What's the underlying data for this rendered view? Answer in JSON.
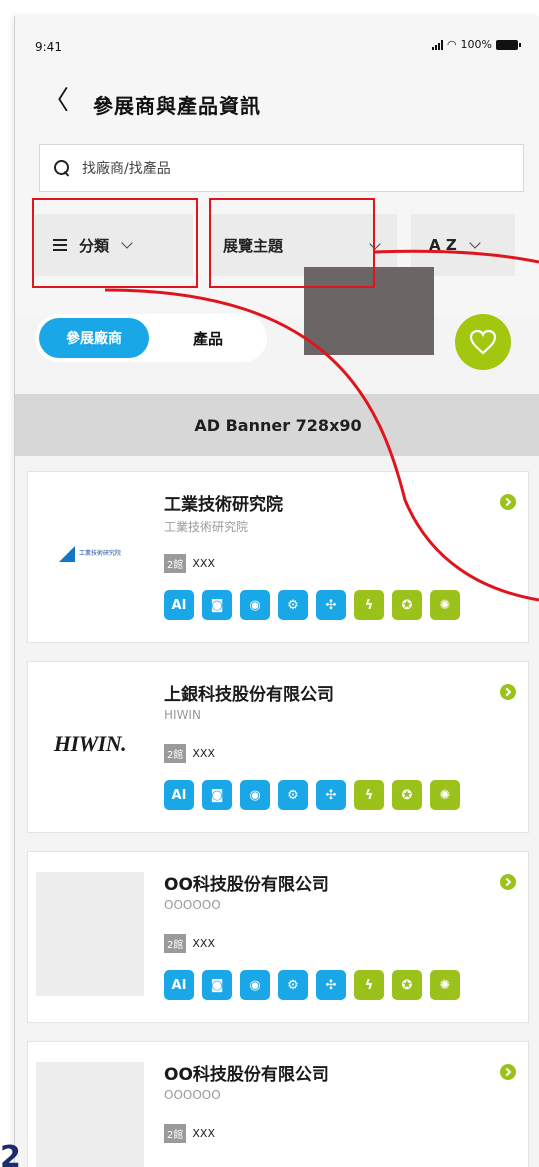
{
  "status": {
    "time": "9:41",
    "battery": "100%"
  },
  "header": {
    "back_icon": "chevron-left-icon",
    "title": "參展商與產品資訊"
  },
  "search": {
    "placeholder": "找廠商/找產品"
  },
  "filters": {
    "category": "分類",
    "theme": "展覽主題",
    "sort": "A Z"
  },
  "segment": {
    "exhibitors": "參展廠商",
    "products": "產品"
  },
  "ad_banner": {
    "label": "AD Banner 728x90"
  },
  "colors": {
    "accent_blue": "#1aa7e8",
    "accent_green": "#a3c60e",
    "annotation_red": "#e0141c"
  },
  "tag_icons": [
    "ai-icon",
    "chip-icon",
    "aiot-icon",
    "robot-icon",
    "network-icon",
    "energy-icon",
    "award-icon",
    "gear-icon"
  ],
  "companies": [
    {
      "name": "工業技術研究院",
      "sub": "工業技術研究院",
      "hall": "2館",
      "booth": "XXX",
      "logo_text": "工業技術研究院"
    },
    {
      "name": "上銀科技股份有限公司",
      "sub": "HIWIN",
      "hall": "2館",
      "booth": "XXX",
      "logo_text": "HIWIN."
    },
    {
      "name": "OO科技股份有限公司",
      "sub": "OOOOOO",
      "hall": "2館",
      "booth": "XXX"
    },
    {
      "name": "OO科技股份有限公司",
      "sub": "OOOOOO",
      "hall": "2館",
      "booth": "XXX"
    }
  ],
  "corner_label": "2"
}
